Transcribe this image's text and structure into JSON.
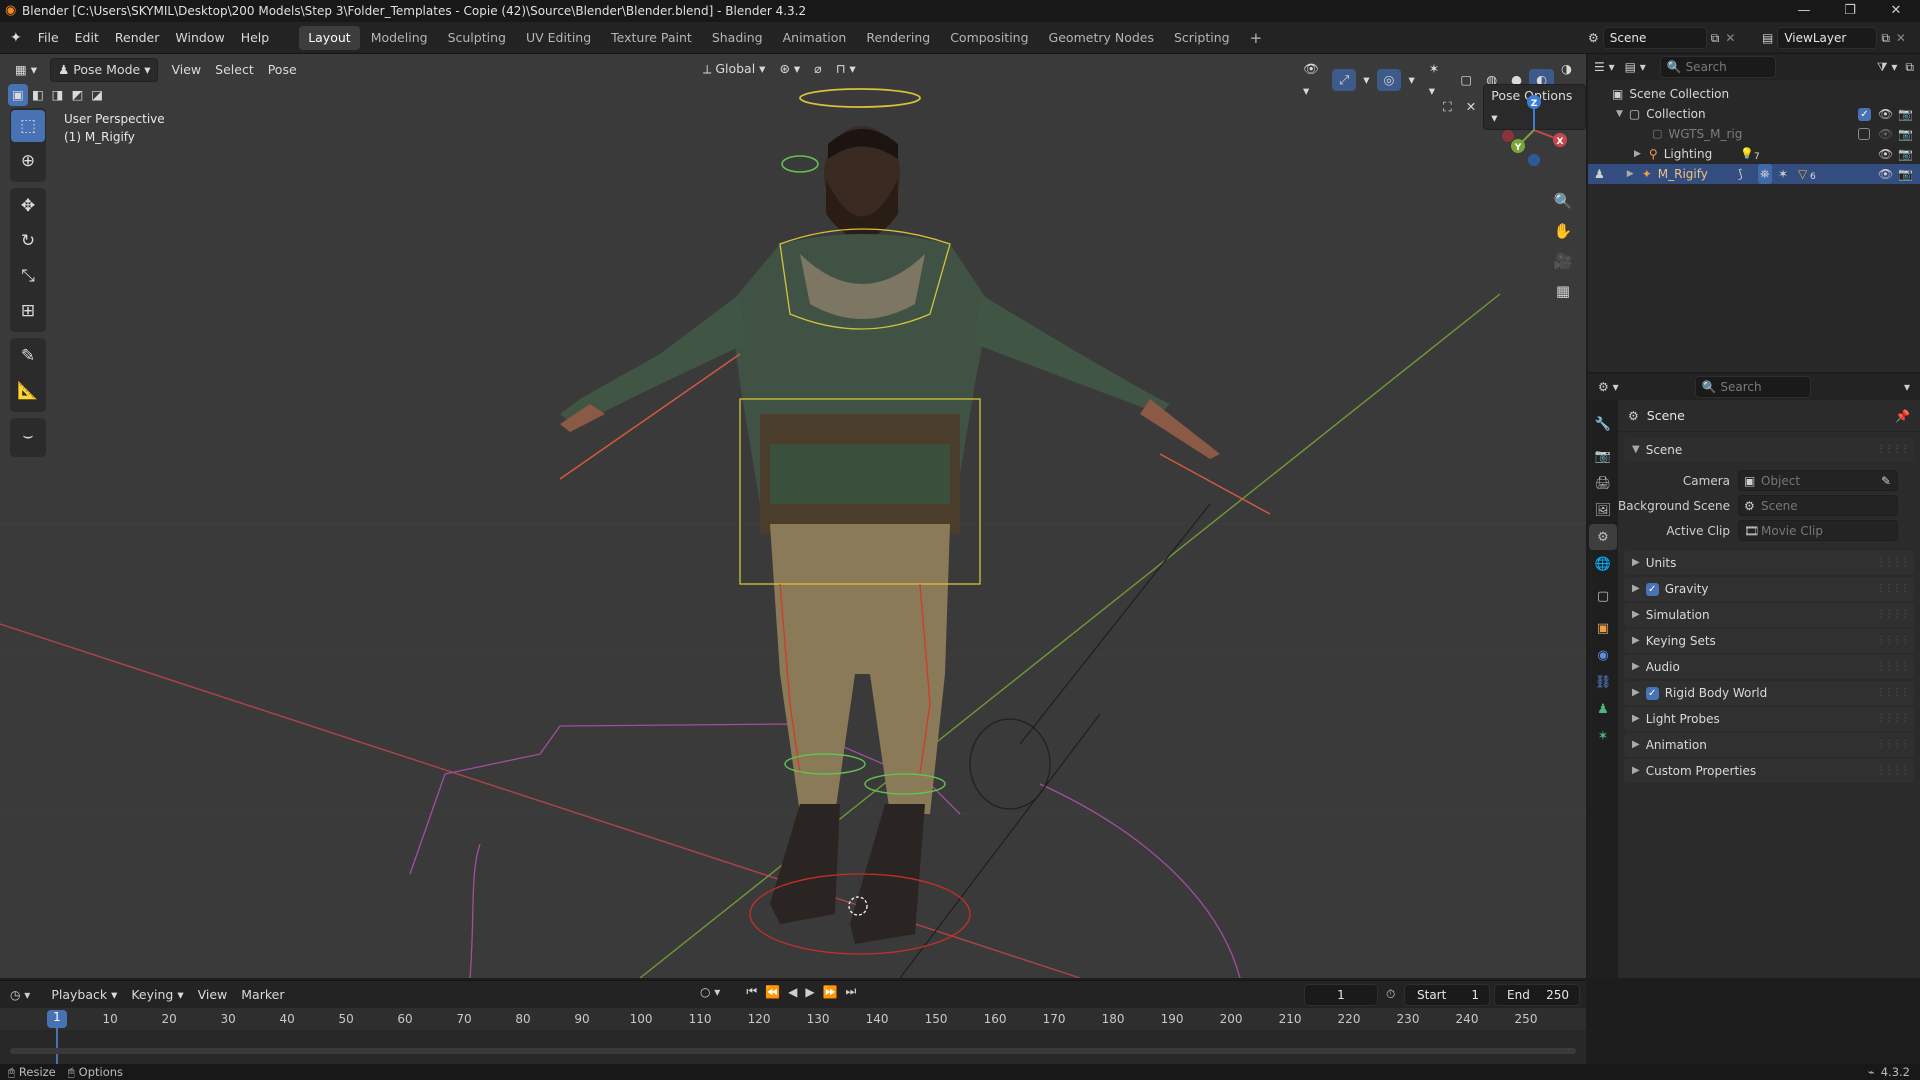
{
  "window": {
    "title": "Blender [C:\\Users\\SKYMIL\\Desktop\\200 Models\\Step 3\\Folder_Templates - Copie (42)\\Source\\Blender\\Blender.blend] - Blender 4.3.2"
  },
  "menu": [
    "File",
    "Edit",
    "Render",
    "Window",
    "Help"
  ],
  "workspaces": [
    "Layout",
    "Modeling",
    "Sculpting",
    "UV Editing",
    "Texture Paint",
    "Shading",
    "Animation",
    "Rendering",
    "Compositing",
    "Geometry Nodes",
    "Scripting"
  ],
  "active_workspace": "Layout",
  "scene_selector": "Scene",
  "viewlayer_selector": "ViewLayer",
  "viewport": {
    "mode": "Pose Mode",
    "menus": [
      "View",
      "Select",
      "Pose"
    ],
    "transform_orientation": "Global",
    "pose_options": "Pose Options",
    "overlay_line1": "User Perspective",
    "overlay_line2": "(1) M_Rigify",
    "gizmo_axes": [
      "Z",
      "X",
      "Y"
    ]
  },
  "outliner": {
    "search_placeholder": "Search",
    "root": "Scene Collection",
    "collection": "Collection",
    "items": [
      {
        "name": "WGTS_M_rig",
        "dim": true
      },
      {
        "name": "Lighting",
        "badge": "7"
      },
      {
        "name": "M_Rigify",
        "selected": true,
        "badge": "6"
      }
    ]
  },
  "properties": {
    "search_placeholder": "Search",
    "context_title": "Scene",
    "scene_panel": "Scene",
    "rows": [
      {
        "label": "Camera",
        "placeholder": "Object"
      },
      {
        "label": "Background Scene",
        "placeholder": "Scene"
      },
      {
        "label": "Active Clip",
        "placeholder": "Movie Clip"
      }
    ],
    "panels": [
      {
        "label": "Units",
        "checkbox": false
      },
      {
        "label": "Gravity",
        "checkbox": true
      },
      {
        "label": "Simulation",
        "checkbox": false
      },
      {
        "label": "Keying Sets",
        "checkbox": false
      },
      {
        "label": "Audio",
        "checkbox": false
      },
      {
        "label": "Rigid Body World",
        "checkbox": true
      },
      {
        "label": "Light Probes",
        "checkbox": false
      },
      {
        "label": "Animation",
        "checkbox": false
      },
      {
        "label": "Custom Properties",
        "checkbox": false
      }
    ]
  },
  "timeline": {
    "menus": [
      "Playback",
      "Keying",
      "View",
      "Marker"
    ],
    "current_frame": "1",
    "start_label": "Start",
    "start": "1",
    "end_label": "End",
    "end": "250",
    "ruler": [
      "1",
      "10",
      "20",
      "30",
      "40",
      "50",
      "60",
      "70",
      "80",
      "90",
      "100",
      "110",
      "120",
      "130",
      "140",
      "150",
      "160",
      "170",
      "180",
      "190",
      "200",
      "210",
      "220",
      "230",
      "240",
      "250"
    ]
  },
  "statusbar": {
    "left1": "Resize",
    "left2": "Options",
    "version": "4.3.2"
  },
  "colors": {
    "accent": "#4772b3",
    "selected_row": "#334d80",
    "viewport_bg": "#3a3a3a",
    "x_axis": "#c8474f",
    "y_axis": "#7aa53b",
    "z_axis": "#3b7ed4"
  }
}
